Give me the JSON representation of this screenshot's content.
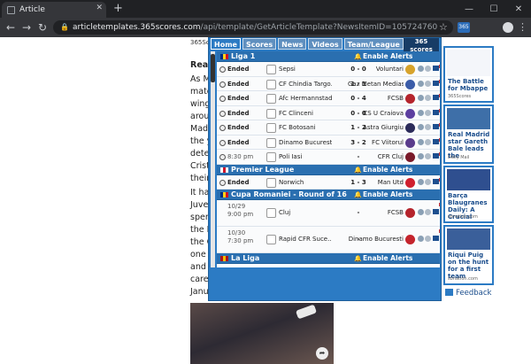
{
  "browser": {
    "tab_title": "Article",
    "close_tab": "✕",
    "new_tab": "+",
    "minimize": "—",
    "maximize": "☐",
    "close_window": "✕",
    "url_host": "articletemplates.365scores.com",
    "url_path": "/api/template/GetArticleTemplate?NewsItemID=105724760"
  },
  "article": {
    "topline": "365Scor",
    "lines": [
      {
        "text": "Real",
        "bold": true
      },
      {
        "text": "As M",
        "bold": false
      },
      {
        "text": "matc",
        "bold": false
      },
      {
        "text": "winge",
        "bold": false
      },
      {
        "text": "aroun",
        "bold": false
      },
      {
        "text": "Madr",
        "bold": false
      },
      {
        "text": "the y",
        "bold": false
      },
      {
        "text": "deter",
        "bold": false
      },
      {
        "text": "Cristi",
        "bold": false
      },
      {
        "text": "their",
        "bold": false
      },
      {
        "text": "It has",
        "bold": false
      },
      {
        "text": "Juve",
        "bold": false
      },
      {
        "text": "spen",
        "bold": false
      },
      {
        "text": "the P",
        "bold": false
      },
      {
        "text": "the C",
        "bold": false
      },
      {
        "text": "one c",
        "bold": false
      },
      {
        "text": "and J",
        "bold": false
      },
      {
        "text": "caree",
        "bold": false
      },
      {
        "text": "Janu",
        "bold": false
      }
    ],
    "share_icon": "➦"
  },
  "popup": {
    "tabs": [
      {
        "label": "Home",
        "active": true
      },
      {
        "label": "Scores",
        "active": false
      },
      {
        "label": "News",
        "active": false
      },
      {
        "label": "Videos",
        "active": false
      },
      {
        "label": "Team/League",
        "active": false
      }
    ],
    "gear": "⚙",
    "logo": "365\nscores",
    "enable_alerts": "Enable Alerts",
    "leagues": [
      {
        "name": "Liga 1",
        "flag": [
          "#002b7f",
          "#fcd116",
          "#ce1126"
        ],
        "matches": [
          {
            "status": "Ended",
            "home": "Sepsi",
            "score": "0 - 0",
            "away": "Voluntari",
            "acrest": "#d7a32b"
          },
          {
            "status": "Ended",
            "home": "CF Chindia Targo…",
            "score": "1 - 1",
            "away": "Gaz Metan Medias",
            "acrest": "#3b5ca8"
          },
          {
            "status": "Ended",
            "home": "Afc Hermannstadt",
            "score": "0 - 4",
            "away": "FCSB",
            "acrest": "#b5242c"
          },
          {
            "status": "Ended",
            "home": "FC Clinceni",
            "score": "0 - 0",
            "away": "CS U Craiova",
            "acrest": "#5d3fa0"
          },
          {
            "status": "Ended",
            "home": "FC Botosani",
            "score": "1 - 2",
            "away": "Astra Giurgiu",
            "acrest": "#2b2b5a"
          },
          {
            "status": "Ended",
            "home": "Dinamo Bucuresti",
            "score": "3 - 2",
            "away": "FC Viitorul",
            "acrest": "#5a3c8c"
          },
          {
            "status": "8:30 pm",
            "home": "Poli Iasi",
            "score": "-",
            "away": "CFR Cluj",
            "acrest": "#7a1a2a"
          }
        ]
      },
      {
        "name": "Premier League",
        "flag": [
          "#ffffff",
          "#cf142b",
          "#ffffff"
        ],
        "matches": [
          {
            "status": "Ended",
            "home": "Norwich",
            "score": "1 - 3",
            "away": "Man Utd",
            "acrest": "#d0202e"
          }
        ]
      },
      {
        "name": "Cupa Romaniei - Round of 16",
        "flag": [
          "#002b7f",
          "#fcd116",
          "#ce1126"
        ],
        "matches": [
          {
            "status": "10/29 9:00 pm",
            "home": "Cluj",
            "score": "-",
            "away": "FCSB",
            "acrest": "#b5242c"
          },
          {
            "status": "10/30 7:30 pm",
            "home": "Rapid CFR Suce…",
            "score": "-",
            "away": "Dinamo Bucuresti",
            "acrest": "#c4242c"
          }
        ]
      },
      {
        "name": "La Liga",
        "flag": [
          "#aa151b",
          "#f1bf00",
          "#aa151b"
        ],
        "matches": []
      }
    ]
  },
  "news": {
    "items": [
      {
        "title": "The Battle for Mbappe",
        "source": "365Scores",
        "img": "#f4f6fa"
      },
      {
        "title": "Real Madrid star Gareth Bale leads the",
        "source": "Daily Mail",
        "img": "#3e6fa8"
      },
      {
        "title": "Barça Blaugranes Daily: A Crucial",
        "source": "sbnation.com",
        "img": "#2f4f8f"
      },
      {
        "title": "Riqui Puig on the hunt for a first team",
        "source": "sbnation.com",
        "img": "#3a5f9a"
      }
    ],
    "feedback": "Feedback"
  }
}
